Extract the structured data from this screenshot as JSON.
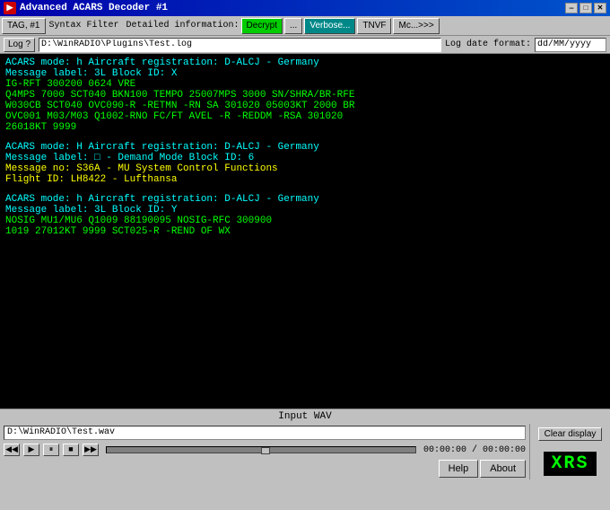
{
  "titlebar": {
    "title": "Advanced ACARS Decoder #1",
    "icon": "▶",
    "minimize": "—",
    "maximize": "□",
    "close": "✕"
  },
  "toolbar1": {
    "btn1": "TAG, #1",
    "syntax_filter": "Syntax Filter",
    "detailed_info": "Detailed information:",
    "btn2": "Decrypt",
    "btn3": "...",
    "btn4": "Verbose...",
    "btn5": "TNVF",
    "btn6": "Mc...>>>"
  },
  "toolbar2": {
    "log_btn": "Log ?",
    "file_path": "D:\\WinRADIO\\Plugins\\Test.log",
    "log_date_label": "Log date format:",
    "log_date_format": "dd/MM/yyyy"
  },
  "messages": [
    {
      "lines": [
        {
          "text": "ACARS mode: h  Aircraft registration: D-ALCJ - Germany",
          "color": "cyan"
        },
        {
          "text": "Message label: 3L  Block ID: X",
          "color": "cyan"
        },
        {
          "text": "IG-RFT 300200 0624 VRE",
          "color": "green"
        },
        {
          "text": "Q4MPS 7000 SCT040 BKN100 TEMPO 25007MPS 3000 SN/SHRA/BR-RFE",
          "color": "green"
        },
        {
          "text": "W030CB SCT040 OVC090-R -RETMN -RN SA 301020 05003KT 2000 BR",
          "color": "green"
        },
        {
          "text": " OVC001 M03/M03 Q1002-RNO FC/FT AVEL -R -REDDM -RSA 301020",
          "color": "green"
        },
        {
          "text": "26018KT 9999",
          "color": "green"
        }
      ]
    },
    {
      "lines": [
        {
          "text": "ACARS mode: H  Aircraft registration: D-ALCJ - Germany",
          "color": "cyan"
        },
        {
          "text": "Message label: □ - Demand Mode  Block ID: 6",
          "color": "cyan"
        },
        {
          "text": "Message no: S36A - MU System Control Functions",
          "color": "yellow"
        },
        {
          "text": "Flight ID: LH8422 - Lufthansa",
          "color": "yellow"
        }
      ]
    },
    {
      "lines": [
        {
          "text": "ACARS mode: h  Aircraft registration: D-ALCJ - Germany",
          "color": "cyan"
        },
        {
          "text": "Message label: 3L  Block ID: Y",
          "color": "cyan"
        },
        {
          "text": "NOSIG MU1/MU6 Q1009 88190095 NOSIG-RFC 300900",
          "color": "green"
        },
        {
          "text": "1019 27012KT 9999 SCT025-R -REND OF WX",
          "color": "green"
        }
      ]
    }
  ],
  "bottom": {
    "wav_label": "Input WAV",
    "wav_file": "D:\\WinRADIO\\Test.wav",
    "clear_display": "Clear display",
    "xrs": "XRS",
    "time": "00:00:00 / 00:00:00",
    "help_btn": "Help",
    "about_btn": "About",
    "transport": {
      "rewind": "◀◀",
      "play": "▶",
      "pause": "⏸",
      "stop": "■",
      "forward": "▶▶"
    }
  }
}
